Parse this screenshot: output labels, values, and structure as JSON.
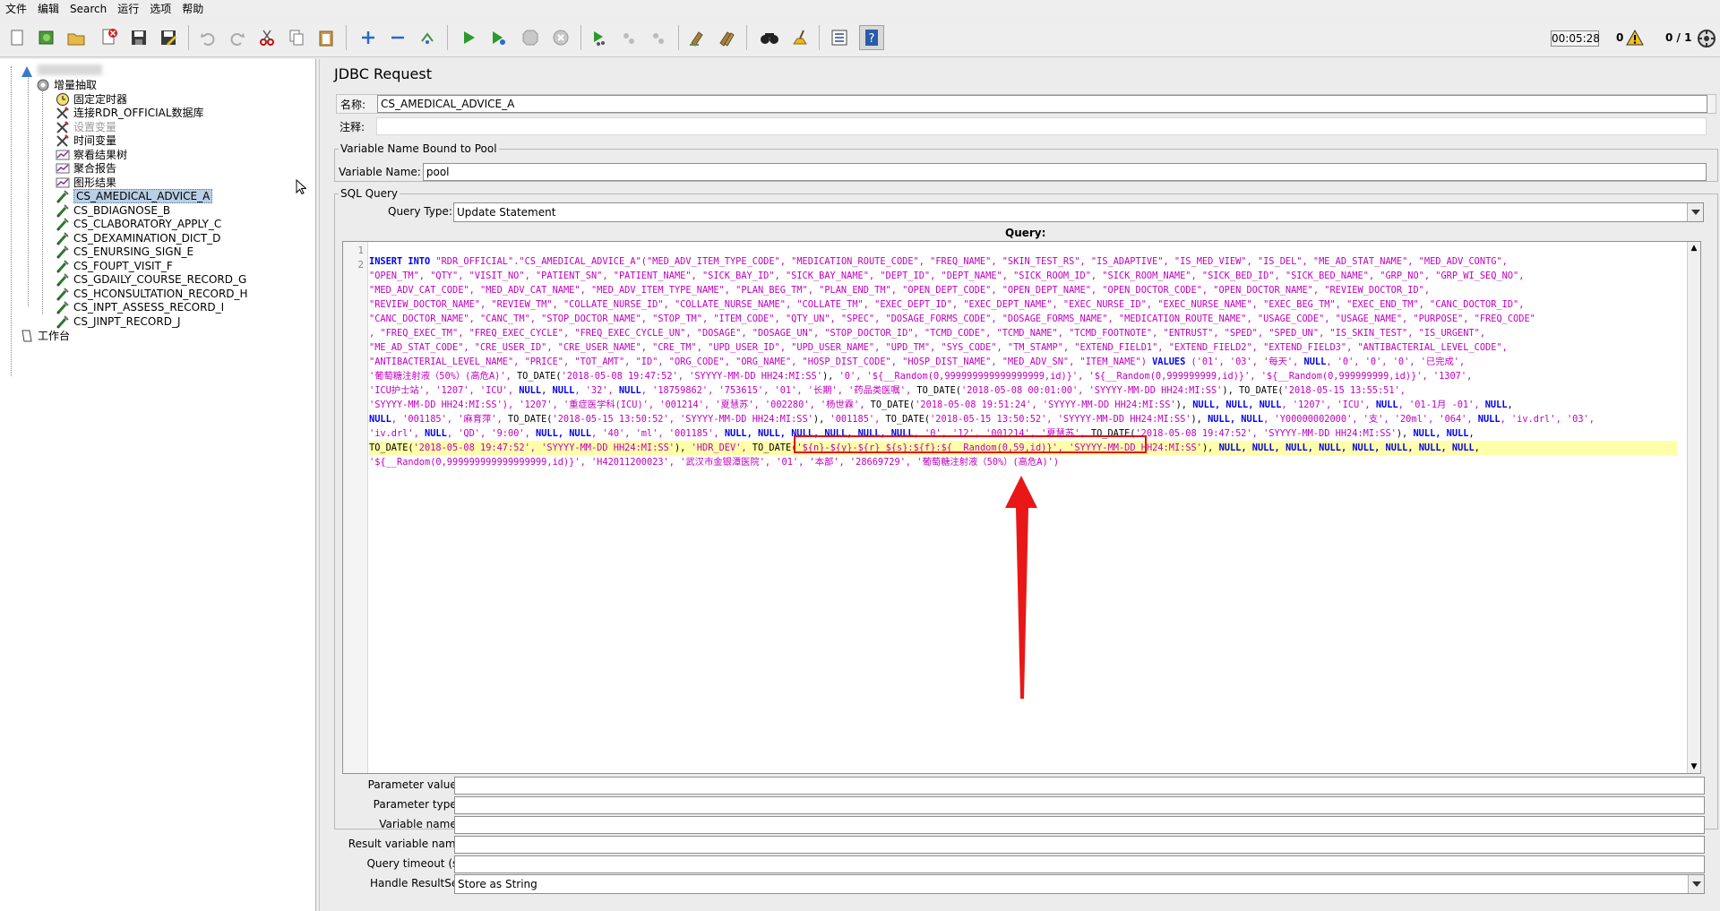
{
  "menu": [
    "文件",
    "编辑",
    "Search",
    "运行",
    "选项",
    "帮助"
  ],
  "toolbar": {
    "timer": "00:05:28",
    "errors": "0",
    "threads": "0 / 1",
    "icons": [
      "new-icon",
      "templates-icon",
      "open-icon",
      "close-icon",
      "save-icon",
      "save-as-icon",
      "undo-icon",
      "redo-icon",
      "cut-icon",
      "copy-icon",
      "paste-icon",
      "expand-icon",
      "collapse-icon",
      "toggle-icon",
      "start-icon",
      "start-no-pause-icon",
      "stop-icon",
      "shutdown-icon",
      "remote-start-icon",
      "remote-stop-icon",
      "remote-exit-icon",
      "clear-icon",
      "clear-all-icon",
      "search-icon",
      "reset-search-icon",
      "function-helper-icon",
      "help-icon"
    ]
  },
  "tree": {
    "items": [
      {
        "label": "",
        "icon": "test-plan-icon"
      },
      {
        "label": "增量抽取",
        "icon": "thread-group-icon"
      },
      {
        "label": "固定定时器",
        "icon": "timer-icon"
      },
      {
        "label": "连接RDR_OFFICIAL数据库",
        "icon": "config-icon"
      },
      {
        "label": "设置变量",
        "icon": "config-icon"
      },
      {
        "label": "时间变量",
        "icon": "config-icon"
      },
      {
        "label": "察看结果树",
        "icon": "listener-icon"
      },
      {
        "label": "聚合报告",
        "icon": "listener-icon"
      },
      {
        "label": "图形结果",
        "icon": "listener-icon"
      },
      {
        "label": "CS_AMEDICAL_ADVICE_A",
        "icon": "sampler-icon"
      },
      {
        "label": "CS_BDIAGNOSE_B",
        "icon": "sampler-icon"
      },
      {
        "label": "CS_CLABORATORY_APPLY_C",
        "icon": "sampler-icon"
      },
      {
        "label": "CS_DEXAMINATION_DICT_D",
        "icon": "sampler-icon"
      },
      {
        "label": "CS_ENURSING_SIGN_E",
        "icon": "sampler-icon"
      },
      {
        "label": "CS_FOUPT_VISIT_F",
        "icon": "sampler-icon"
      },
      {
        "label": "CS_GDAILY_COURSE_RECORD_G",
        "icon": "sampler-icon"
      },
      {
        "label": "CS_HCONSULTATION_RECORD_H",
        "icon": "sampler-icon"
      },
      {
        "label": "CS_INPT_ASSESS_RECORD_I",
        "icon": "sampler-icon"
      },
      {
        "label": "CS_JINPT_RECORD_J",
        "icon": "sampler-icon"
      },
      {
        "label": "工作台",
        "icon": "workbench-icon"
      }
    ]
  },
  "panel": {
    "title": "JDBC Request",
    "name_label": "名称:",
    "name_value": "CS_AMEDICAL_ADVICE_A",
    "comment_label": "注释:",
    "comment_value": "",
    "pool_legend": "Variable Name Bound to Pool",
    "varname_label": "Variable Name:",
    "varname_value": "pool",
    "sql_legend": "SQL Query",
    "querytype_label": "Query Type:",
    "querytype_value": "Update Statement",
    "query_label": "Query:",
    "param_values_label": "Parameter values:",
    "param_types_label": "Parameter types:",
    "var_names_label": "Variable names:",
    "result_var_label": "Result variable name:",
    "timeout_label": "Query timeout (s):",
    "resultset_label": "Handle ResultSet:",
    "resultset_value": "Store as String"
  },
  "editor": {
    "line_numbers": [
      "1",
      "2"
    ],
    "lines": [
      [
        [
          "kw",
          "INSERT INTO "
        ],
        [
          "st",
          "\"RDR_OFFICIAL\".\"CS_AMEDICAL_ADVICE_A\"(\"MED_ADV_ITEM_TYPE_CODE\", \"MEDICATION_ROUTE_CODE\", \"FREQ_NAME\", \"SKIN_TEST_RS\", \"IS_ADAPTIVE\", \"IS_MED_VIEW\", \"IS_DEL\", \"ME_AD_STAT_NAME\", \"MED_ADV_CONTG\","
        ]
      ],
      [
        [
          "st",
          "\"OPEN_TM\", \"QTY\", \"VISIT_NO\", \"PATIENT_SN\", \"PATIENT_NAME\", \"SICK_BAY_ID\", \"SICK_BAY_NAME\", \"DEPT_ID\", \"DEPT_NAME\", \"SICK_ROOM_ID\", \"SICK_ROOM_NAME\", \"SICK_BED_ID\", \"SICK_BED_NAME\", \"GRP_NO\", \"GRP_WI_SEQ_NO\","
        ]
      ],
      [
        [
          "st",
          "\"MED_ADV_CAT_CODE\", \"MED_ADV_CAT_NAME\", \"MED_ADV_ITEM_TYPE_NAME\", \"PLAN_BEG_TM\", \"PLAN_END_TM\", \"OPEN_DEPT_CODE\", \"OPEN_DEPT_NAME\", \"OPEN_DOCTOR_CODE\", \"OPEN_DOCTOR_NAME\", \"REVIEW_DOCTOR_ID\","
        ]
      ],
      [
        [
          "st",
          "\"REVIEW_DOCTOR_NAME\", \"REVIEW_TM\", \"COLLATE_NURSE_ID\", \"COLLATE_NURSE_NAME\", \"COLLATE_TM\", \"EXEC_DEPT_ID\", \"EXEC_DEPT_NAME\", \"EXEC_NURSE_ID\", \"EXEC_NURSE_NAME\", \"EXEC_BEG_TM\", \"EXEC_END_TM\", \"CANC_DOCTOR_ID\","
        ]
      ],
      [
        [
          "st",
          "\"CANC_DOCTOR_NAME\", \"CANC_TM\", \"STOP_DOCTOR_NAME\", \"STOP_TM\", \"ITEM_CODE\", \"QTY_UN\", \"SPEC\", \"DOSAGE_FORMS_CODE\", \"DOSAGE_FORMS_NAME\", \"MEDICATION_ROUTE_NAME\", \"USAGE_CODE\", \"USAGE_NAME\", \"PURPOSE\", \"FREQ_CODE\""
        ]
      ],
      [
        [
          "st",
          ", \"FREQ_EXEC_TM\", \"FREQ_EXEC_CYCLE\", \"FREQ_EXEC_CYCLE_UN\", \"DOSAGE\", \"DOSAGE_UN\", \"STOP_DOCTOR_ID\", \"TCMD_CODE\", \"TCMD_NAME\", \"TCMD_FOOTNOTE\", \"ENTRUST\", \"SPED\", \"SPED_UN\", \"IS_SKIN_TEST\", \"IS_URGENT\","
        ]
      ],
      [
        [
          "st",
          "\"ME_AD_STAT_CODE\", \"CRE_USER_ID\", \"CRE_USER_NAME\", \"CRE_TM\", \"UPD_USER_ID\", \"UPD_USER_NAME\", \"UPD_TM\", \"SYS_CODE\", \"TM_STAMP\", \"EXTEND_FIELD1\", \"EXTEND_FIELD2\", \"EXTEND_FIELD3\", \"ANTIBACTERIAL_LEVEL_CODE\","
        ]
      ],
      [
        [
          "st",
          "\"ANTIBACTERIAL_LEVEL_NAME\", \"PRICE\", \"TOT_AMT\", \"ID\", \"ORG_CODE\", \"ORG_NAME\", \"HOSP_DIST_CODE\", \"HOSP_DIST_NAME\", \"MED_ADV_SN\", \"ITEM_NAME\") "
        ],
        [
          "kw",
          "VALUES"
        ],
        [
          "st",
          " ('01', '03', '每天', "
        ],
        [
          "nl",
          "NULL"
        ],
        [
          "st",
          ", '0', '0', '0', '已完成',"
        ]
      ],
      [
        [
          "st",
          "'葡萄糖注射液（50%）(高危A)', "
        ],
        [
          "",
          "TO_DATE("
        ],
        [
          "st",
          "'2018-05-08 19:47:52', 'SYYYY-MM-DD HH24:MI:SS'"
        ],
        [
          "",
          "), "
        ],
        [
          "st",
          "'0', '${__Random(0,999999999999999999,id)}', '${__Random(0,999999999,id)}', '${__Random(0,999999999,id)}', '1307',"
        ]
      ],
      [
        [
          "st",
          "'ICU护士站', '1207', 'ICU', "
        ],
        [
          "nl",
          "NULL"
        ],
        [
          "",
          ", "
        ],
        [
          "nl",
          "NULL"
        ],
        [
          "st",
          ", '32', "
        ],
        [
          "nl",
          "NULL"
        ],
        [
          "st",
          ", '18759862', '753615', '01', '长期', '药品类医嘱', "
        ],
        [
          "",
          "TO_DATE("
        ],
        [
          "st",
          "'2018-05-08 00:01:00', 'SYYYY-MM-DD HH24:MI:SS'"
        ],
        [
          "",
          "), TO_DATE("
        ],
        [
          "st",
          "'2018-05-15 13:55:51',"
        ]
      ],
      [
        [
          "st",
          "'SYYYY-MM-DD HH24:MI:SS'), '1207', '重症医学科(ICU)', '001214', '夏慧苏', '002280', '杨世霖', "
        ],
        [
          "",
          "TO_DATE("
        ],
        [
          "st",
          "'2018-05-08 19:51:24', 'SYYYY-MM-DD HH24:MI:SS'"
        ],
        [
          "",
          "), "
        ],
        [
          "nl",
          "NULL, NULL, NULL"
        ],
        [
          "st",
          ", '1207', 'ICU', "
        ],
        [
          "nl",
          "NULL"
        ],
        [
          "st",
          ", '01-1月 -01', "
        ],
        [
          "nl",
          "NULL"
        ],
        [
          "",
          ","
        ]
      ],
      [
        [
          "nl",
          "NULL"
        ],
        [
          "st",
          ", '001185', '麻育萍', "
        ],
        [
          "",
          "TO_DATE("
        ],
        [
          "st",
          "'2018-05-15 13:50:52', 'SYYYY-MM-DD HH24:MI:SS'"
        ],
        [
          "",
          "), "
        ],
        [
          "st",
          "'001185', "
        ],
        [
          "",
          "TO_DATE("
        ],
        [
          "st",
          "'2018-05-15 13:50:52', 'SYYYY-MM-DD HH24:MI:SS'"
        ],
        [
          "",
          "), "
        ],
        [
          "nl",
          "NULL, NULL"
        ],
        [
          "st",
          ", 'Y00000002000', '支', '20ml', '064', "
        ],
        [
          "nl",
          "NULL"
        ],
        [
          "st",
          ", 'iv.drl', '03',"
        ]
      ],
      [
        [
          "st",
          "'iv.drl', "
        ],
        [
          "nl",
          "NULL"
        ],
        [
          "st",
          ", 'QD', '9:00', "
        ],
        [
          "nl",
          "NULL, NULL"
        ],
        [
          "st",
          ", '40', 'ml', '001185', "
        ],
        [
          "nl",
          "NULL, NULL, NULL, NULL, NULL, NULL"
        ],
        [
          "st",
          ", '0', '12', '001214', '夏慧苏', "
        ],
        [
          "",
          "TO_DATE("
        ],
        [
          "st",
          "'2018-05-08 19:47:52', 'SYYYY-MM-DD HH24:MI:SS'"
        ],
        [
          "",
          "), "
        ],
        [
          "nl",
          "NULL, NULL"
        ],
        [
          "",
          ","
        ]
      ],
      [
        [
          "",
          "TO_DATE("
        ],
        [
          "st",
          "'2018-05-08 19:47:52', 'SYYYY-MM-DD HH24:MI:SS'"
        ],
        [
          "",
          "), "
        ],
        [
          "st",
          "'HDR_DEV', "
        ],
        [
          "",
          "TO_DATE("
        ],
        [
          "st",
          "'${n}-${y}-${r} ${s}:${f}:${__Random(0,59,id)}', 'SYYYY-MM-DD HH24:MI:SS'"
        ],
        [
          "",
          "), "
        ],
        [
          "nl",
          "NULL, NULL, NULL, NULL, NULL, NULL, NULL, NULL"
        ],
        [
          "",
          ","
        ]
      ],
      [
        [
          "st",
          "'${__Random(0,999999999999999999,id)}', 'H42011200023', '武汉市金银潭医院', '01', '本部', '28669729', '葡萄糖注射液（50%）(高危A)')"
        ]
      ]
    ]
  }
}
